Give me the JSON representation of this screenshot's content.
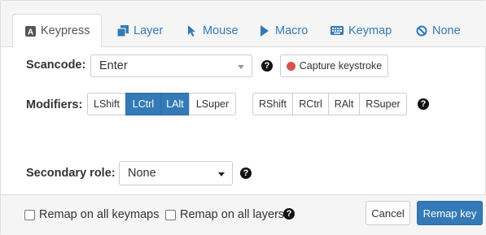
{
  "tabs": [
    {
      "label": "Keypress",
      "icon": "keyboard-a-icon",
      "active": true
    },
    {
      "label": "Layer",
      "icon": "layers-icon"
    },
    {
      "label": "Mouse",
      "icon": "mouse-pointer-icon"
    },
    {
      "label": "Macro",
      "icon": "play-icon"
    },
    {
      "label": "Keymap",
      "icon": "keyboard-icon"
    },
    {
      "label": "None",
      "icon": "ban-icon"
    }
  ],
  "scancode": {
    "label": "Scancode:",
    "value": "Enter",
    "help": "?"
  },
  "capture": {
    "label": "Capture keystroke",
    "dot_color": "#d9534f"
  },
  "modifiers": {
    "label": "Modifiers:",
    "left": [
      {
        "label": "LShift",
        "active": false
      },
      {
        "label": "LCtrl",
        "active": true
      },
      {
        "label": "LAlt",
        "active": true
      },
      {
        "label": "LSuper",
        "active": false
      }
    ],
    "right": [
      {
        "label": "RShift",
        "active": false
      },
      {
        "label": "RCtrl",
        "active": false
      },
      {
        "label": "RAlt",
        "active": false
      },
      {
        "label": "RSuper",
        "active": false
      }
    ],
    "help": "?"
  },
  "secondary": {
    "label": "Secondary role:",
    "value": "None",
    "help": "?"
  },
  "footer": {
    "remap_keymaps": "Remap on all keymaps",
    "remap_layers": "Remap on all layers",
    "help": "?",
    "cancel": "Cancel",
    "remap": "Remap key"
  },
  "colors": {
    "primary": "#337ab7",
    "link": "#337ab7",
    "danger": "#d9534f"
  }
}
